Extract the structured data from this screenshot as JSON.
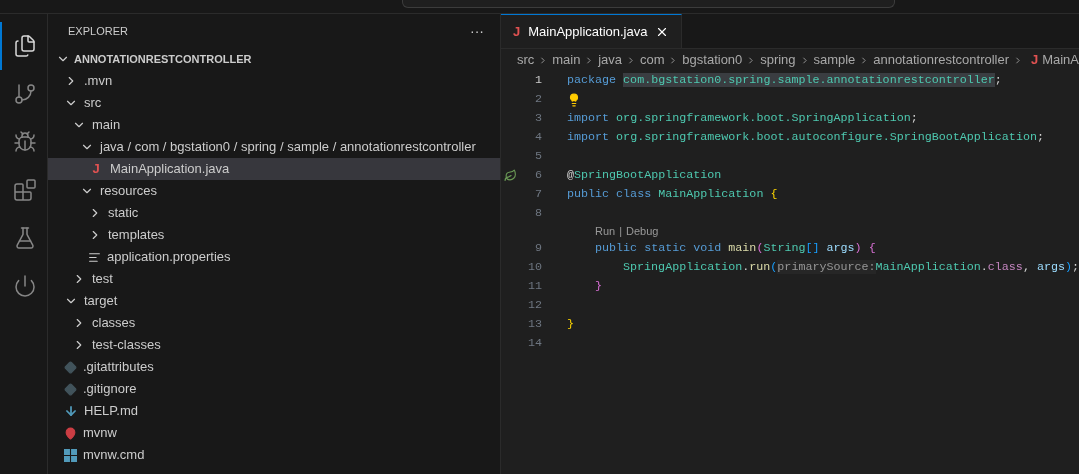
{
  "activity_bar": [
    {
      "kind": "files",
      "selected": true
    },
    {
      "kind": "source-control",
      "selected": false
    },
    {
      "kind": "run-debug",
      "selected": false
    },
    {
      "kind": "extensions",
      "selected": false
    },
    {
      "kind": "testing",
      "selected": false
    },
    {
      "kind": "spring",
      "selected": false
    }
  ],
  "explorer": {
    "title": "EXPLORER",
    "more": "···",
    "root": {
      "label": "ANNOTATIONRESTCONTROLLER",
      "expanded": true
    },
    "tree": [
      {
        "label": ".mvn",
        "kind": "folder",
        "expanded": false,
        "selected": false
      },
      {
        "label": "src",
        "kind": "folder",
        "expanded": true,
        "selected": false,
        "children": [
          {
            "label": "main",
            "kind": "folder",
            "expanded": true,
            "selected": false,
            "children": [
              {
                "label": "java / com / bgstation0 / spring / sample / annotationrestcontroller",
                "kind": "folder",
                "expanded": true,
                "selected": false,
                "children": [
                  {
                    "label": "MainApplication.java",
                    "kind": "java",
                    "icon_letter": "J",
                    "selected": true
                  }
                ]
              },
              {
                "label": "resources",
                "kind": "folder",
                "expanded": true,
                "selected": false,
                "children": [
                  {
                    "label": "static",
                    "kind": "folder",
                    "expanded": false,
                    "selected": false
                  },
                  {
                    "label": "templates",
                    "kind": "folder",
                    "expanded": false,
                    "selected": false
                  },
                  {
                    "label": "application.properties",
                    "kind": "properties",
                    "selected": false
                  }
                ]
              }
            ]
          },
          {
            "label": "test",
            "kind": "folder",
            "expanded": false,
            "selected": false
          }
        ]
      },
      {
        "label": "target",
        "kind": "folder",
        "expanded": true,
        "selected": false,
        "children": [
          {
            "label": "classes",
            "kind": "folder",
            "expanded": false,
            "selected": false
          },
          {
            "label": "test-classes",
            "kind": "folder",
            "expanded": false,
            "selected": false
          }
        ]
      },
      {
        "label": ".gitattributes",
        "kind": "git",
        "selected": false
      },
      {
        "label": ".gitignore",
        "kind": "git",
        "selected": false
      },
      {
        "label": "HELP.md",
        "kind": "markdown",
        "selected": false
      },
      {
        "label": "mvnw",
        "kind": "maven",
        "selected": false
      },
      {
        "label": "mvnw.cmd",
        "kind": "windows",
        "selected": false
      }
    ]
  },
  "editor": {
    "tabs": [
      {
        "label": "MainApplication.java",
        "icon_letter": "J",
        "selected": true
      }
    ],
    "breadcrumb": [
      {
        "label": "src"
      },
      {
        "label": "main"
      },
      {
        "label": "java"
      },
      {
        "label": "com"
      },
      {
        "label": "bgstation0"
      },
      {
        "label": "spring"
      },
      {
        "label": "sample"
      },
      {
        "label": "annotationrestcontroller"
      },
      {
        "label": "MainA",
        "icon_letter": "J"
      }
    ],
    "lines": [
      {
        "number": "1",
        "current": true,
        "tokens": [
          {
            "text": "package ",
            "kind": "keyword"
          },
          {
            "text": "com.bgstation0.spring.sample.annotationrestcontroller",
            "kind": "highlight"
          },
          {
            "text": ";",
            "kind": "plain"
          }
        ]
      },
      {
        "number": "2",
        "current": false,
        "lightbulb": true
      },
      {
        "number": "3",
        "current": false,
        "tokens": [
          {
            "text": "import",
            "kind": "keyword"
          },
          {
            "text": " org.springframework.boot.",
            "kind": "namespace"
          },
          {
            "text": "SpringApplication",
            "kind": "type"
          },
          {
            "text": ";",
            "kind": "plain"
          }
        ]
      },
      {
        "number": "4",
        "current": false,
        "tokens": [
          {
            "text": "import",
            "kind": "keyword"
          },
          {
            "text": " org.springframework.boot.autoconfigure.",
            "kind": "namespace"
          },
          {
            "text": "SpringBootApplication",
            "kind": "type"
          },
          {
            "text": ";",
            "kind": "plain"
          }
        ]
      },
      {
        "number": "5",
        "current": false
      },
      {
        "number": "6",
        "current": false,
        "bean_marker": true,
        "tokens": [
          {
            "text": "@",
            "kind": "plain"
          },
          {
            "text": "SpringBootApplication",
            "kind": "type"
          }
        ]
      },
      {
        "number": "7",
        "current": false,
        "tokens": [
          {
            "text": "public class ",
            "kind": "keyword"
          },
          {
            "text": "MainApplication",
            "kind": "type"
          },
          {
            "text": " {",
            "kind": "bracket1"
          }
        ]
      },
      {
        "number": "8",
        "current": false
      },
      {
        "number": "9",
        "current": false,
        "lens": {
          "items": [
            "Run",
            "Debug"
          ],
          "separator": "|"
        },
        "tokens": [
          {
            "text": "    public static void ",
            "kind": "keyword"
          },
          {
            "text": "main",
            "kind": "function"
          },
          {
            "text": "(",
            "kind": "bracket2"
          },
          {
            "text": "String",
            "kind": "type"
          },
          {
            "text": "[]",
            "kind": "bracket3"
          },
          {
            "text": " args",
            "kind": "param"
          },
          {
            "text": ") {",
            "kind": "bracket2"
          }
        ]
      },
      {
        "number": "10",
        "current": false,
        "tokens": [
          {
            "text": "        SpringApplication",
            "kind": "type"
          },
          {
            "text": ".",
            "kind": "plain"
          },
          {
            "text": "run",
            "kind": "function"
          },
          {
            "text": "(",
            "kind": "bracket3"
          },
          {
            "text": "primarySource:",
            "kind": "hint"
          },
          {
            "text": "MainApplication",
            "kind": "type"
          },
          {
            "text": ".",
            "kind": "plain"
          },
          {
            "text": "class",
            "kind": "keyword2"
          },
          {
            "text": ",",
            "kind": "plain"
          },
          {
            "text": " args",
            "kind": "param"
          },
          {
            "text": ")",
            "kind": "bracket3"
          },
          {
            "text": ";",
            "kind": "plain"
          }
        ]
      },
      {
        "number": "11",
        "current": false,
        "tokens": [
          {
            "text": "    }",
            "kind": "bracket2"
          }
        ]
      },
      {
        "number": "12",
        "current": false
      },
      {
        "number": "13",
        "current": false,
        "tokens": [
          {
            "text": "}",
            "kind": "bracket1"
          }
        ]
      },
      {
        "number": "14",
        "current": false
      }
    ]
  }
}
